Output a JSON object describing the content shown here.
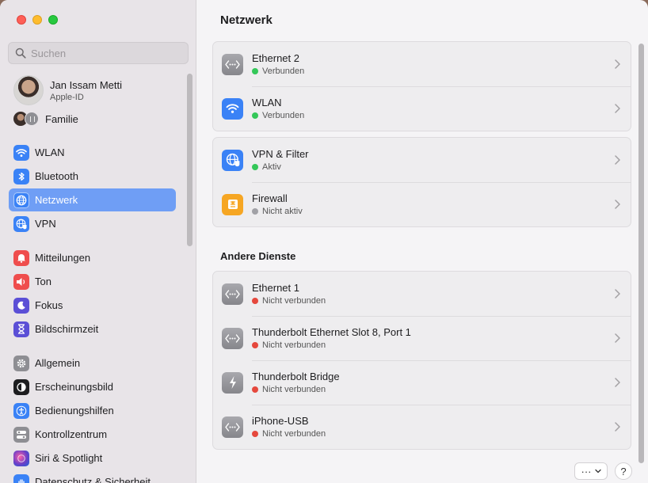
{
  "window": {
    "buttons": {
      "close": "close",
      "minimize": "minimize",
      "zoom": "zoom"
    }
  },
  "sidebar": {
    "search_placeholder": "Suchen",
    "account": {
      "name": "Jan Issam Metti",
      "subtitle": "Apple-ID"
    },
    "family": {
      "label": "Familie"
    },
    "items": [
      {
        "label": "WLAN",
        "icon": "wifi-icon",
        "color": "#3a82f6"
      },
      {
        "label": "Bluetooth",
        "icon": "bluetooth-icon",
        "color": "#3a82f6"
      },
      {
        "label": "Netzwerk",
        "icon": "globe-icon",
        "color": "#3a82f6",
        "active": true
      },
      {
        "label": "VPN",
        "icon": "vpn-globe-icon",
        "color": "#3a82f6"
      },
      {
        "label": "Mitteilungen",
        "icon": "bell-icon",
        "color": "#ef4d4d"
      },
      {
        "label": "Ton",
        "icon": "speaker-icon",
        "color": "#ef4d4d"
      },
      {
        "label": "Fokus",
        "icon": "moon-icon",
        "color": "#5b4fd6"
      },
      {
        "label": "Bildschirmzeit",
        "icon": "hourglass-icon",
        "color": "#5b4fd6"
      },
      {
        "label": "Allgemein",
        "icon": "gear-icon",
        "color": "#8e8e93"
      },
      {
        "label": "Erscheinungsbild",
        "icon": "appearance-icon",
        "color": "#1d1d1f"
      },
      {
        "label": "Bedienungshilfen",
        "icon": "accessibility-icon",
        "color": "#3a82f6"
      },
      {
        "label": "Kontrollzentrum",
        "icon": "toggles-icon",
        "color": "#8e8e93"
      },
      {
        "label": "Siri & Spotlight",
        "icon": "siri-icon",
        "color": "#6a3fc8"
      },
      {
        "label": "Datenschutz & Sicherheit",
        "icon": "hand-icon",
        "color": "#3a82f6"
      }
    ]
  },
  "main": {
    "title": "Netzwerk",
    "groups": [
      {
        "rows": [
          {
            "name": "Ethernet 2",
            "status": "Verbunden",
            "status_color": "#34c759",
            "icon": "ethernet-icon"
          },
          {
            "name": "WLAN",
            "status": "Verbunden",
            "status_color": "#34c759",
            "icon": "wifi-icon"
          }
        ]
      },
      {
        "rows": [
          {
            "name": "VPN & Filter",
            "status": "Aktiv",
            "status_color": "#34c759",
            "icon": "vpn-globe-icon"
          },
          {
            "name": "Firewall",
            "status": "Nicht aktiv",
            "status_color": "#a1a1a6",
            "icon": "firewall-icon"
          }
        ]
      }
    ],
    "section_title": "Andere Dienste",
    "other_services": [
      {
        "name": "Ethernet 1",
        "status": "Nicht verbunden",
        "status_color": "#e5483d",
        "icon": "ethernet-icon"
      },
      {
        "name": "Thunderbolt Ethernet Slot 8, Port 1",
        "status": "Nicht verbunden",
        "status_color": "#e5483d",
        "icon": "ethernet-icon"
      },
      {
        "name": "Thunderbolt Bridge",
        "status": "Nicht verbunden",
        "status_color": "#e5483d",
        "icon": "thunderbolt-icon"
      },
      {
        "name": "iPhone-USB",
        "status": "Nicht verbunden",
        "status_color": "#e5483d",
        "icon": "ethernet-icon"
      }
    ],
    "more_label": "···",
    "help_label": "?"
  }
}
